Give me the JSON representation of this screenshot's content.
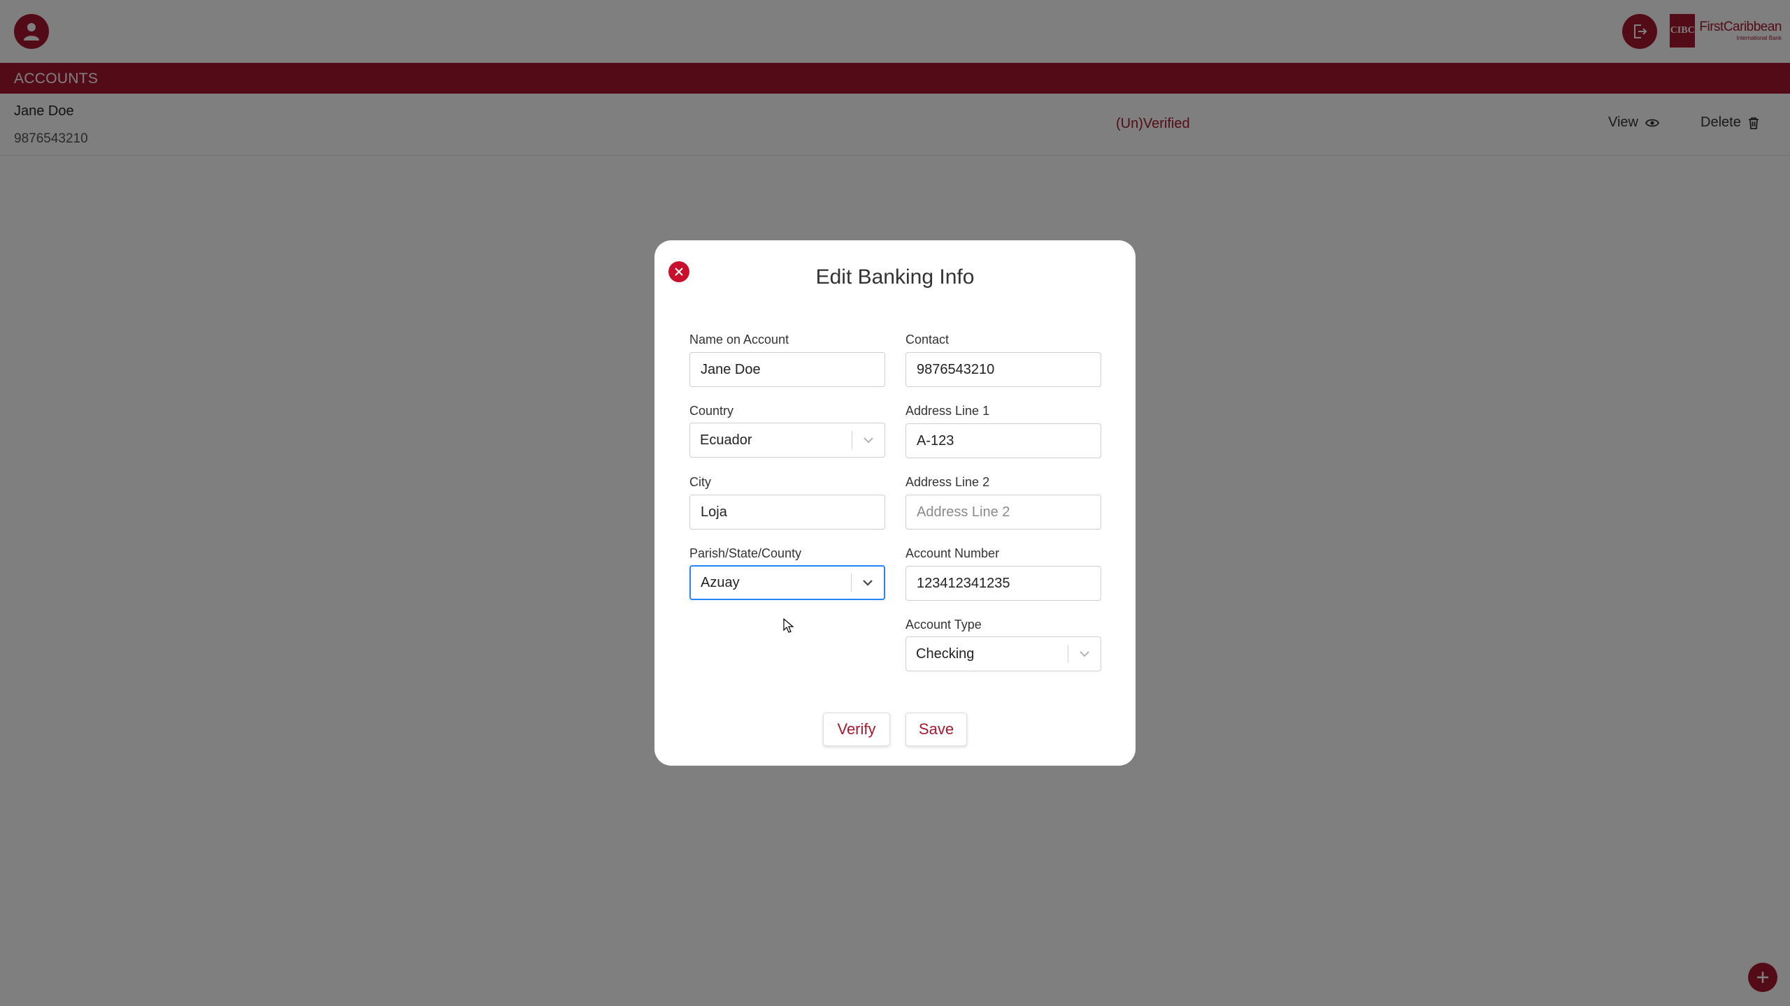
{
  "header": {
    "user_icon": "user-avatar-icon",
    "logout_icon": "logout-icon",
    "brand": {
      "mark": "CIBC",
      "name": "FirstCaribbean",
      "sub": "International Bank"
    }
  },
  "section": {
    "title": "ACCOUNTS"
  },
  "account_row": {
    "name": "Jane Doe",
    "phone": "9876543210",
    "status": "(Un)Verified",
    "view_label": "View",
    "delete_label": "Delete"
  },
  "modal": {
    "title": "Edit Banking Info",
    "fields": {
      "name_on_account": {
        "label": "Name on Account",
        "value": "Jane Doe"
      },
      "contact": {
        "label": "Contact",
        "value": "9876543210"
      },
      "country": {
        "label": "Country",
        "value": "Ecuador"
      },
      "address_line_1": {
        "label": "Address Line 1",
        "value": "A-123"
      },
      "city": {
        "label": "City",
        "value": "Loja"
      },
      "address_line_2": {
        "label": "Address Line 2",
        "value": "",
        "placeholder": "Address Line 2"
      },
      "parish": {
        "label": "Parish/State/County",
        "value": "Azuay"
      },
      "account_number": {
        "label": "Account Number",
        "value": "123412341235"
      },
      "account_type": {
        "label": "Account Type",
        "value": "Checking"
      }
    },
    "buttons": {
      "verify": "Verify",
      "save": "Save"
    }
  },
  "colors": {
    "brand": "#a6192e",
    "close": "#c8102e",
    "focus": "#2684ff",
    "overlay": "rgba(0,0,0,0.5)"
  }
}
